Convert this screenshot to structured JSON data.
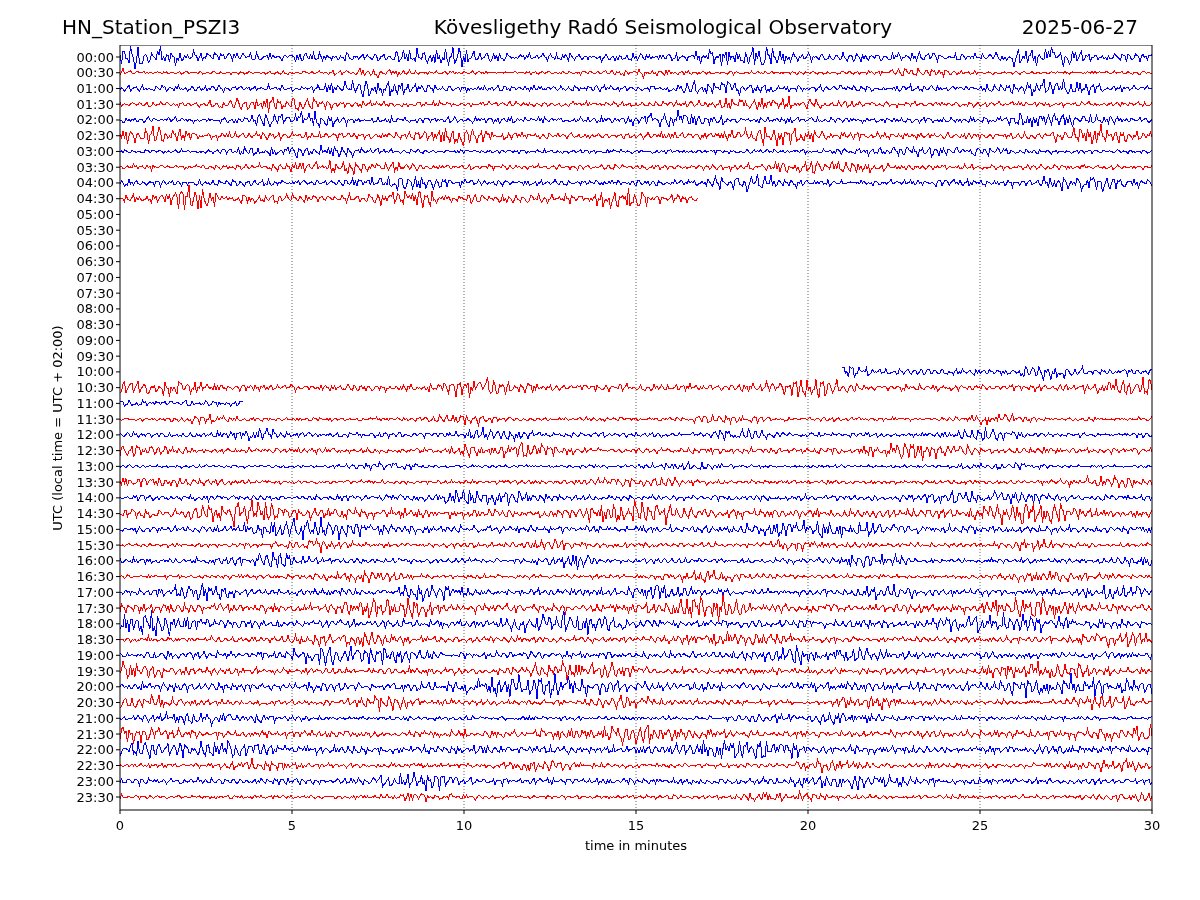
{
  "header": {
    "station": "HN_Station_PSZI3",
    "title": "Kövesligethy Radó Seismological Observatory",
    "date": "2025-06-27"
  },
  "plot": {
    "ylabel": "UTC (local time = UTC + 02:00)",
    "xlabel": "time in minutes",
    "xticks": [
      "0",
      "5",
      "10",
      "15",
      "20",
      "25",
      "30"
    ],
    "rows": [
      {
        "label": "00:00",
        "color": "#0000ff",
        "level": 1,
        "kind": "from_start"
      },
      {
        "label": "00:30",
        "color": "#ff0000",
        "level": 1,
        "kind": "from_start"
      },
      {
        "label": "01:00",
        "color": "#0000ff",
        "level": 1,
        "kind": "from_start"
      },
      {
        "label": "01:30",
        "color": "#ff0000",
        "level": 1,
        "kind": "from_start"
      },
      {
        "label": "02:00",
        "color": "#0000ff",
        "level": 1,
        "kind": "from_start"
      },
      {
        "label": "02:30",
        "color": "#ff0000",
        "level": 1,
        "kind": "from_start"
      },
      {
        "label": "03:00",
        "color": "#0000ff",
        "level": 1,
        "kind": "from_start"
      },
      {
        "label": "03:30",
        "color": "#ff0000",
        "level": 1,
        "kind": "from_start"
      },
      {
        "label": "04:00",
        "color": "#0000ff",
        "level": 1,
        "kind": "from_start"
      },
      {
        "label": "04:30",
        "color": "#ff0000",
        "level": 0.56,
        "kind": "from_start"
      },
      {
        "label": "05:00"
      },
      {
        "label": "05:30"
      },
      {
        "label": "06:00"
      },
      {
        "label": "06:30"
      },
      {
        "label": "07:00"
      },
      {
        "label": "07:30"
      },
      {
        "label": "08:00"
      },
      {
        "label": "08:30"
      },
      {
        "label": "09:00"
      },
      {
        "label": "09:30"
      },
      {
        "label": "10:00",
        "color": "#0000ff",
        "level": 0.3,
        "kind": "from_end"
      },
      {
        "label": "10:30",
        "color": "#ff0000",
        "level": 1,
        "kind": "from_start"
      },
      {
        "label": "11:00",
        "color": "#0000ff",
        "level": 0.12,
        "kind": "from_start"
      },
      {
        "label": "11:30",
        "color": "#ff0000",
        "level": 1,
        "kind": "from_start"
      },
      {
        "label": "12:00",
        "color": "#0000ff",
        "level": 1,
        "kind": "from_start"
      },
      {
        "label": "12:30",
        "color": "#ff0000",
        "level": 1,
        "kind": "from_start"
      },
      {
        "label": "13:00",
        "color": "#0000ff",
        "level": 1,
        "kind": "from_start"
      },
      {
        "label": "13:30",
        "color": "#ff0000",
        "level": 1,
        "kind": "from_start"
      },
      {
        "label": "14:00",
        "color": "#0000ff",
        "level": 1,
        "kind": "from_start"
      },
      {
        "label": "14:30",
        "color": "#ff0000",
        "level": 1,
        "kind": "from_start"
      },
      {
        "label": "15:00",
        "color": "#0000ff",
        "level": 1,
        "kind": "from_start"
      },
      {
        "label": "15:30",
        "color": "#ff0000",
        "level": 1,
        "kind": "from_start"
      },
      {
        "label": "16:00",
        "color": "#0000ff",
        "level": 1,
        "kind": "from_start"
      },
      {
        "label": "16:30",
        "color": "#ff0000",
        "level": 1,
        "kind": "from_start"
      },
      {
        "label": "17:00",
        "color": "#0000ff",
        "level": 1,
        "kind": "from_start"
      },
      {
        "label": "17:30",
        "color": "#ff0000",
        "level": 1,
        "kind": "from_start"
      },
      {
        "label": "18:00",
        "color": "#0000ff",
        "level": 1,
        "kind": "from_start"
      },
      {
        "label": "18:30",
        "color": "#ff0000",
        "level": 1,
        "kind": "from_start"
      },
      {
        "label": "19:00",
        "color": "#0000ff",
        "level": 1,
        "kind": "from_start"
      },
      {
        "label": "19:30",
        "color": "#ff0000",
        "level": 1,
        "kind": "from_start"
      },
      {
        "label": "20:00",
        "color": "#0000ff",
        "level": 1,
        "kind": "from_start"
      },
      {
        "label": "20:30",
        "color": "#ff0000",
        "level": 1,
        "kind": "from_start"
      },
      {
        "label": "21:00",
        "color": "#0000ff",
        "level": 1,
        "kind": "from_start"
      },
      {
        "label": "21:30",
        "color": "#ff0000",
        "level": 1,
        "kind": "from_start"
      },
      {
        "label": "22:00",
        "color": "#0000ff",
        "level": 1,
        "kind": "from_start"
      },
      {
        "label": "22:30",
        "color": "#ff0000",
        "level": 1,
        "kind": "from_start"
      },
      {
        "label": "23:00",
        "color": "#0000ff",
        "level": 1,
        "kind": "from_start"
      },
      {
        "label": "23:30",
        "color": "#ff0000",
        "level": 1,
        "kind": "from_start"
      }
    ]
  }
}
